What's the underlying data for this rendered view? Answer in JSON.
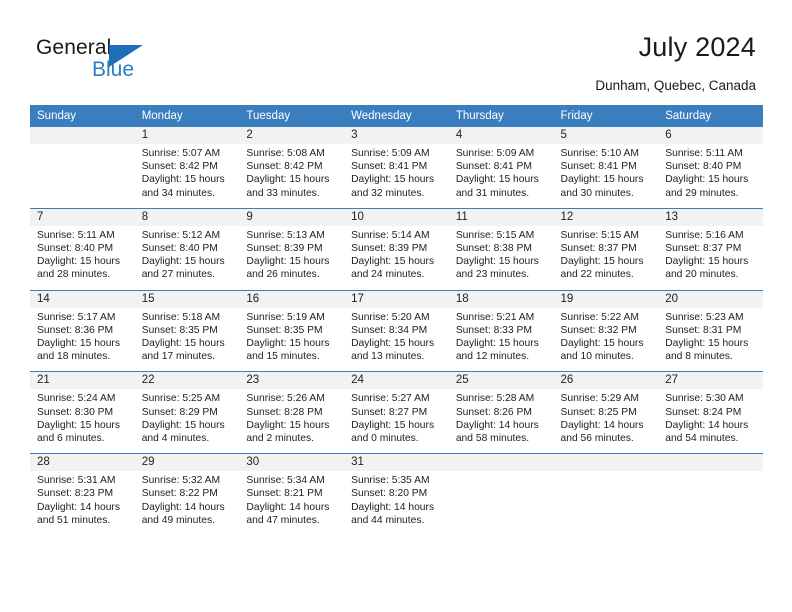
{
  "brand": {
    "name_part1": "General",
    "name_part2": "Blue",
    "accent_color": "#2E7DC4",
    "triangle_color": "#1F6FB8"
  },
  "header": {
    "title": "July 2024",
    "location": "Dunham, Quebec, Canada"
  },
  "calendar": {
    "header_bg": "#3A7EBF",
    "header_text_color": "#FFFFFF",
    "daynum_bg": "#F2F2F2",
    "weekday_headers": [
      "Sunday",
      "Monday",
      "Tuesday",
      "Wednesday",
      "Thursday",
      "Friday",
      "Saturday"
    ],
    "weeks": [
      [
        {
          "day": "",
          "sunrise": "",
          "sunset": "",
          "daylight_line1": "",
          "daylight_line2": ""
        },
        {
          "day": "1",
          "sunrise": "Sunrise: 5:07 AM",
          "sunset": "Sunset: 8:42 PM",
          "daylight_line1": "Daylight: 15 hours",
          "daylight_line2": "and 34 minutes."
        },
        {
          "day": "2",
          "sunrise": "Sunrise: 5:08 AM",
          "sunset": "Sunset: 8:42 PM",
          "daylight_line1": "Daylight: 15 hours",
          "daylight_line2": "and 33 minutes."
        },
        {
          "day": "3",
          "sunrise": "Sunrise: 5:09 AM",
          "sunset": "Sunset: 8:41 PM",
          "daylight_line1": "Daylight: 15 hours",
          "daylight_line2": "and 32 minutes."
        },
        {
          "day": "4",
          "sunrise": "Sunrise: 5:09 AM",
          "sunset": "Sunset: 8:41 PM",
          "daylight_line1": "Daylight: 15 hours",
          "daylight_line2": "and 31 minutes."
        },
        {
          "day": "5",
          "sunrise": "Sunrise: 5:10 AM",
          "sunset": "Sunset: 8:41 PM",
          "daylight_line1": "Daylight: 15 hours",
          "daylight_line2": "and 30 minutes."
        },
        {
          "day": "6",
          "sunrise": "Sunrise: 5:11 AM",
          "sunset": "Sunset: 8:40 PM",
          "daylight_line1": "Daylight: 15 hours",
          "daylight_line2": "and 29 minutes."
        }
      ],
      [
        {
          "day": "7",
          "sunrise": "Sunrise: 5:11 AM",
          "sunset": "Sunset: 8:40 PM",
          "daylight_line1": "Daylight: 15 hours",
          "daylight_line2": "and 28 minutes."
        },
        {
          "day": "8",
          "sunrise": "Sunrise: 5:12 AM",
          "sunset": "Sunset: 8:40 PM",
          "daylight_line1": "Daylight: 15 hours",
          "daylight_line2": "and 27 minutes."
        },
        {
          "day": "9",
          "sunrise": "Sunrise: 5:13 AM",
          "sunset": "Sunset: 8:39 PM",
          "daylight_line1": "Daylight: 15 hours",
          "daylight_line2": "and 26 minutes."
        },
        {
          "day": "10",
          "sunrise": "Sunrise: 5:14 AM",
          "sunset": "Sunset: 8:39 PM",
          "daylight_line1": "Daylight: 15 hours",
          "daylight_line2": "and 24 minutes."
        },
        {
          "day": "11",
          "sunrise": "Sunrise: 5:15 AM",
          "sunset": "Sunset: 8:38 PM",
          "daylight_line1": "Daylight: 15 hours",
          "daylight_line2": "and 23 minutes."
        },
        {
          "day": "12",
          "sunrise": "Sunrise: 5:15 AM",
          "sunset": "Sunset: 8:37 PM",
          "daylight_line1": "Daylight: 15 hours",
          "daylight_line2": "and 22 minutes."
        },
        {
          "day": "13",
          "sunrise": "Sunrise: 5:16 AM",
          "sunset": "Sunset: 8:37 PM",
          "daylight_line1": "Daylight: 15 hours",
          "daylight_line2": "and 20 minutes."
        }
      ],
      [
        {
          "day": "14",
          "sunrise": "Sunrise: 5:17 AM",
          "sunset": "Sunset: 8:36 PM",
          "daylight_line1": "Daylight: 15 hours",
          "daylight_line2": "and 18 minutes."
        },
        {
          "day": "15",
          "sunrise": "Sunrise: 5:18 AM",
          "sunset": "Sunset: 8:35 PM",
          "daylight_line1": "Daylight: 15 hours",
          "daylight_line2": "and 17 minutes."
        },
        {
          "day": "16",
          "sunrise": "Sunrise: 5:19 AM",
          "sunset": "Sunset: 8:35 PM",
          "daylight_line1": "Daylight: 15 hours",
          "daylight_line2": "and 15 minutes."
        },
        {
          "day": "17",
          "sunrise": "Sunrise: 5:20 AM",
          "sunset": "Sunset: 8:34 PM",
          "daylight_line1": "Daylight: 15 hours",
          "daylight_line2": "and 13 minutes."
        },
        {
          "day": "18",
          "sunrise": "Sunrise: 5:21 AM",
          "sunset": "Sunset: 8:33 PM",
          "daylight_line1": "Daylight: 15 hours",
          "daylight_line2": "and 12 minutes."
        },
        {
          "day": "19",
          "sunrise": "Sunrise: 5:22 AM",
          "sunset": "Sunset: 8:32 PM",
          "daylight_line1": "Daylight: 15 hours",
          "daylight_line2": "and 10 minutes."
        },
        {
          "day": "20",
          "sunrise": "Sunrise: 5:23 AM",
          "sunset": "Sunset: 8:31 PM",
          "daylight_line1": "Daylight: 15 hours",
          "daylight_line2": "and 8 minutes."
        }
      ],
      [
        {
          "day": "21",
          "sunrise": "Sunrise: 5:24 AM",
          "sunset": "Sunset: 8:30 PM",
          "daylight_line1": "Daylight: 15 hours",
          "daylight_line2": "and 6 minutes."
        },
        {
          "day": "22",
          "sunrise": "Sunrise: 5:25 AM",
          "sunset": "Sunset: 8:29 PM",
          "daylight_line1": "Daylight: 15 hours",
          "daylight_line2": "and 4 minutes."
        },
        {
          "day": "23",
          "sunrise": "Sunrise: 5:26 AM",
          "sunset": "Sunset: 8:28 PM",
          "daylight_line1": "Daylight: 15 hours",
          "daylight_line2": "and 2 minutes."
        },
        {
          "day": "24",
          "sunrise": "Sunrise: 5:27 AM",
          "sunset": "Sunset: 8:27 PM",
          "daylight_line1": "Daylight: 15 hours",
          "daylight_line2": "and 0 minutes."
        },
        {
          "day": "25",
          "sunrise": "Sunrise: 5:28 AM",
          "sunset": "Sunset: 8:26 PM",
          "daylight_line1": "Daylight: 14 hours",
          "daylight_line2": "and 58 minutes."
        },
        {
          "day": "26",
          "sunrise": "Sunrise: 5:29 AM",
          "sunset": "Sunset: 8:25 PM",
          "daylight_line1": "Daylight: 14 hours",
          "daylight_line2": "and 56 minutes."
        },
        {
          "day": "27",
          "sunrise": "Sunrise: 5:30 AM",
          "sunset": "Sunset: 8:24 PM",
          "daylight_line1": "Daylight: 14 hours",
          "daylight_line2": "and 54 minutes."
        }
      ],
      [
        {
          "day": "28",
          "sunrise": "Sunrise: 5:31 AM",
          "sunset": "Sunset: 8:23 PM",
          "daylight_line1": "Daylight: 14 hours",
          "daylight_line2": "and 51 minutes."
        },
        {
          "day": "29",
          "sunrise": "Sunrise: 5:32 AM",
          "sunset": "Sunset: 8:22 PM",
          "daylight_line1": "Daylight: 14 hours",
          "daylight_line2": "and 49 minutes."
        },
        {
          "day": "30",
          "sunrise": "Sunrise: 5:34 AM",
          "sunset": "Sunset: 8:21 PM",
          "daylight_line1": "Daylight: 14 hours",
          "daylight_line2": "and 47 minutes."
        },
        {
          "day": "31",
          "sunrise": "Sunrise: 5:35 AM",
          "sunset": "Sunset: 8:20 PM",
          "daylight_line1": "Daylight: 14 hours",
          "daylight_line2": "and 44 minutes."
        },
        {
          "day": "",
          "sunrise": "",
          "sunset": "",
          "daylight_line1": "",
          "daylight_line2": ""
        },
        {
          "day": "",
          "sunrise": "",
          "sunset": "",
          "daylight_line1": "",
          "daylight_line2": ""
        },
        {
          "day": "",
          "sunrise": "",
          "sunset": "",
          "daylight_line1": "",
          "daylight_line2": ""
        }
      ]
    ]
  }
}
